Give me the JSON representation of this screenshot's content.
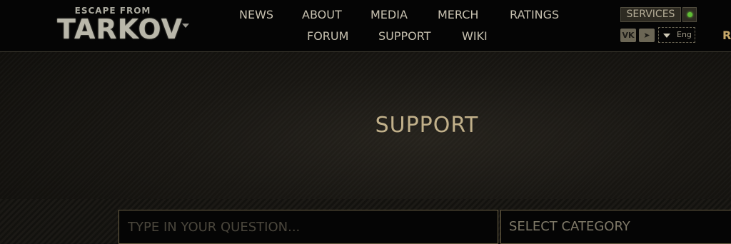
{
  "header": {
    "logo": {
      "line1": "ESCAPE FROM",
      "line2": "TARKOV"
    },
    "nav_row1": [
      "NEWS",
      "ABOUT",
      "MEDIA",
      "MERCH",
      "RATINGS"
    ],
    "nav_row2": [
      "FORUM",
      "SUPPORT",
      "WIKI"
    ],
    "services_label": "SERVICES",
    "services_status_color": "#5fbf35",
    "social": [
      {
        "icon": "vk-icon",
        "glyph": "VK"
      },
      {
        "icon": "telegram-icon",
        "glyph": "➤"
      }
    ],
    "language": "Eng",
    "edge_text": "R"
  },
  "hero": {
    "title": "SUPPORT",
    "search_placeholder": "TYPE IN YOUR QUESTION...",
    "category_label": "SELECT CATEGORY"
  },
  "colors": {
    "accent": "#c1b08a",
    "nav_text": "#c7c1b0",
    "border": "#6a5f44"
  }
}
